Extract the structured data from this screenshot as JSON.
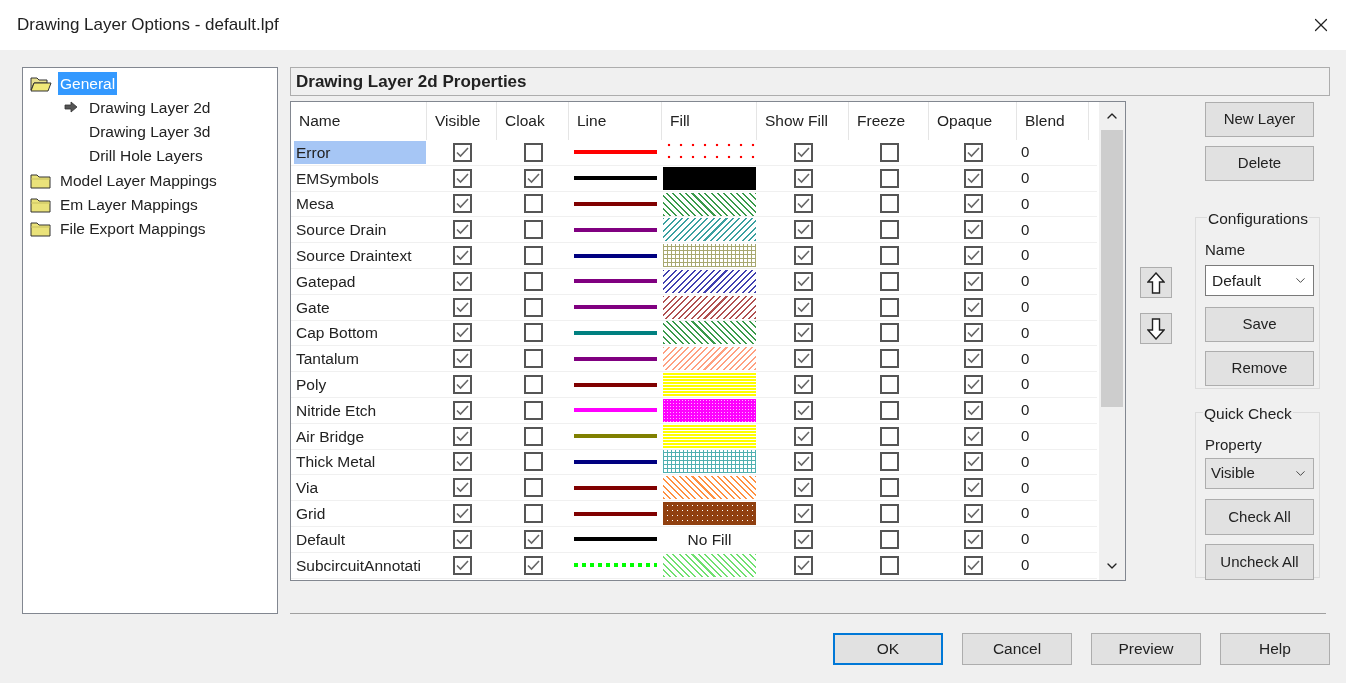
{
  "window": {
    "title": "Drawing Layer Options - default.lpf"
  },
  "tree": [
    {
      "label": "General",
      "expanded": true,
      "selected": true,
      "children": [
        {
          "label": "Drawing Layer 2d",
          "current": true,
          "selected": false
        },
        {
          "label": "Drawing Layer 3d",
          "current": false,
          "selected": false
        },
        {
          "label": "Drill Hole Layers",
          "current": false,
          "selected": false
        }
      ]
    },
    {
      "label": "Model Layer Mappings",
      "expanded": false,
      "selected": false
    },
    {
      "label": "Em Layer Mappings",
      "expanded": false,
      "selected": false
    },
    {
      "label": "File Export Mappings",
      "expanded": false,
      "selected": false
    }
  ],
  "panel_title": "Drawing Layer 2d Properties",
  "table": {
    "columns": [
      "Name",
      "Visible",
      "Cloak",
      "Line",
      "Fill",
      "Show Fill",
      "Freeze",
      "Opaque",
      "Blend"
    ],
    "rows": [
      {
        "name": "Error",
        "selected": true,
        "visible": true,
        "cloak": false,
        "line": {
          "color": "#ff0000",
          "kind": "solid"
        },
        "fill": {
          "kind": "dots",
          "color": "#ff0000"
        },
        "show_fill": true,
        "freeze": false,
        "opaque": true,
        "blend": "0"
      },
      {
        "name": "EMSymbols",
        "selected": false,
        "visible": true,
        "cloak": true,
        "line": {
          "color": "#000000",
          "kind": "solid"
        },
        "fill": {
          "kind": "solid",
          "color": "#000000"
        },
        "show_fill": true,
        "freeze": false,
        "opaque": true,
        "blend": "0"
      },
      {
        "name": "Mesa",
        "selected": false,
        "visible": true,
        "cloak": false,
        "line": {
          "color": "#800000",
          "kind": "solid"
        },
        "fill": {
          "kind": "diag-down",
          "color": "#3a9a4a"
        },
        "show_fill": true,
        "freeze": false,
        "opaque": true,
        "blend": "0"
      },
      {
        "name": "Source Drain",
        "selected": false,
        "visible": true,
        "cloak": false,
        "line": {
          "color": "#800080",
          "kind": "solid"
        },
        "fill": {
          "kind": "diag-up",
          "color": "#3aa0a0"
        },
        "show_fill": true,
        "freeze": false,
        "opaque": true,
        "blend": "0"
      },
      {
        "name": "Source Draintext",
        "selected": false,
        "visible": true,
        "cloak": false,
        "line": {
          "color": "#000080",
          "kind": "solid"
        },
        "fill": {
          "kind": "grid",
          "color": "#a8a870"
        },
        "show_fill": true,
        "freeze": false,
        "opaque": true,
        "blend": "0"
      },
      {
        "name": "Gatepad",
        "selected": false,
        "visible": true,
        "cloak": false,
        "line": {
          "color": "#800080",
          "kind": "solid"
        },
        "fill": {
          "kind": "diag-up",
          "color": "#4040b0"
        },
        "show_fill": true,
        "freeze": false,
        "opaque": true,
        "blend": "0"
      },
      {
        "name": "Gate",
        "selected": false,
        "visible": true,
        "cloak": false,
        "line": {
          "color": "#800080",
          "kind": "solid"
        },
        "fill": {
          "kind": "diag-up",
          "color": "#b05050"
        },
        "show_fill": true,
        "freeze": false,
        "opaque": true,
        "blend": "0"
      },
      {
        "name": "Cap Bottom",
        "selected": false,
        "visible": true,
        "cloak": false,
        "line": {
          "color": "#008080",
          "kind": "solid"
        },
        "fill": {
          "kind": "diag-down",
          "color": "#3a9a4a"
        },
        "show_fill": true,
        "freeze": false,
        "opaque": true,
        "blend": "0"
      },
      {
        "name": "Tantalum",
        "selected": false,
        "visible": true,
        "cloak": false,
        "line": {
          "color": "#800080",
          "kind": "solid"
        },
        "fill": {
          "kind": "diag-up",
          "color": "#ffa080"
        },
        "show_fill": true,
        "freeze": false,
        "opaque": true,
        "blend": "0"
      },
      {
        "name": "Poly",
        "selected": false,
        "visible": true,
        "cloak": false,
        "line": {
          "color": "#800000",
          "kind": "solid"
        },
        "fill": {
          "kind": "hlines",
          "color": "#ffff00"
        },
        "show_fill": true,
        "freeze": false,
        "opaque": true,
        "blend": "0"
      },
      {
        "name": "Nitride Etch",
        "selected": false,
        "visible": true,
        "cloak": false,
        "line": {
          "color": "#ff00ff",
          "kind": "solid"
        },
        "fill": {
          "kind": "fine",
          "color": "#ff00ff"
        },
        "show_fill": true,
        "freeze": false,
        "opaque": true,
        "blend": "0"
      },
      {
        "name": "Air Bridge",
        "selected": false,
        "visible": true,
        "cloak": false,
        "line": {
          "color": "#808000",
          "kind": "solid"
        },
        "fill": {
          "kind": "hlines",
          "color": "#ffff00"
        },
        "show_fill": true,
        "freeze": false,
        "opaque": true,
        "blend": "0"
      },
      {
        "name": "Thick Metal",
        "selected": false,
        "visible": true,
        "cloak": false,
        "line": {
          "color": "#000080",
          "kind": "solid"
        },
        "fill": {
          "kind": "grid",
          "color": "#50b0b0"
        },
        "show_fill": true,
        "freeze": false,
        "opaque": true,
        "blend": "0"
      },
      {
        "name": "Via",
        "selected": false,
        "visible": true,
        "cloak": false,
        "line": {
          "color": "#800000",
          "kind": "solid"
        },
        "fill": {
          "kind": "diag-down",
          "color": "#ff9040"
        },
        "show_fill": true,
        "freeze": false,
        "opaque": true,
        "blend": "0"
      },
      {
        "name": "Grid",
        "selected": false,
        "visible": true,
        "cloak": false,
        "line": {
          "color": "#800000",
          "kind": "solid"
        },
        "fill": {
          "kind": "bold-grid",
          "color": "#904010"
        },
        "show_fill": true,
        "freeze": false,
        "opaque": true,
        "blend": "0"
      },
      {
        "name": "Default",
        "selected": false,
        "visible": true,
        "cloak": true,
        "line": {
          "color": "#000000",
          "kind": "solid"
        },
        "fill": {
          "kind": "none",
          "text": "No Fill"
        },
        "show_fill": true,
        "freeze": false,
        "opaque": true,
        "blend": "0"
      },
      {
        "name": "SubcircuitAnnotati",
        "selected": false,
        "visible": true,
        "cloak": true,
        "line": {
          "color": "#00ff00",
          "kind": "dotted"
        },
        "fill": {
          "kind": "diag-down",
          "color": "#70e070"
        },
        "show_fill": true,
        "freeze": false,
        "opaque": true,
        "blend": "0"
      }
    ]
  },
  "layer_buttons": [
    "New Layer",
    "Delete"
  ],
  "configurations": {
    "title": "Configurations",
    "name_label": "Name",
    "name_value": "Default",
    "buttons": [
      "Save",
      "Remove"
    ]
  },
  "quick_check": {
    "title": "Quick Check",
    "property_label": "Property",
    "property_value": "Visible",
    "buttons": [
      "Check All",
      "Uncheck All"
    ]
  },
  "footer_buttons": [
    {
      "label": "OK",
      "default": true
    },
    {
      "label": "Cancel",
      "default": false
    },
    {
      "label": "Preview",
      "default": false
    },
    {
      "label": "Help",
      "default": false
    }
  ]
}
